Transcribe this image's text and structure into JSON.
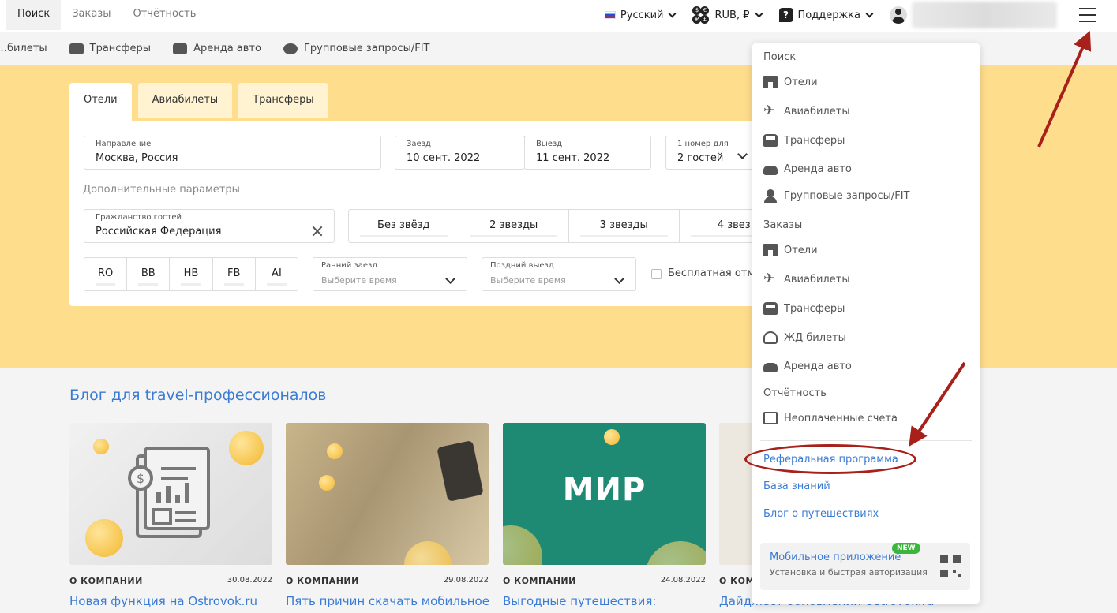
{
  "topnav": {
    "tabs": [
      "Поиск",
      "Заказы",
      "Отчётность"
    ]
  },
  "topright": {
    "language": "Русский",
    "currency": "RUB, ₽",
    "support": "Поддержка"
  },
  "subnav": {
    "items": [
      "…билеты",
      "Трансферы",
      "Аренда авто",
      "Групповые запросы/FIT"
    ]
  },
  "search": {
    "tabs": [
      "Отели",
      "Авиабилеты",
      "Трансферы"
    ],
    "destination": {
      "label": "Направление",
      "value": "Москва, Россия"
    },
    "checkin": {
      "label": "Заезд",
      "value": "10 сент. 2022"
    },
    "checkout": {
      "label": "Выезд",
      "value": "11 сент. 2022"
    },
    "rooms": {
      "label": "1 номер для",
      "value": "2 гостей"
    },
    "advanced": "Дополнительные параметры",
    "citizenship": {
      "label": "Гражданство гостей",
      "value": "Российская Федерация"
    },
    "stars": [
      "Без звёзд",
      "2 звезды",
      "3 звезды",
      "4 звез"
    ],
    "meals": [
      "RO",
      "BB",
      "HB",
      "FB",
      "AI"
    ],
    "early": {
      "label": "Ранний заезд",
      "placeholder": "Выберите время"
    },
    "late": {
      "label": "Поздний выезд",
      "placeholder": "Выберите время"
    },
    "free_cancel": "Бесплатная отме"
  },
  "blog": {
    "title": "Блог для travel-профессионалов",
    "posts": [
      {
        "category": "О КОМПАНИИ",
        "date": "30.08.2022",
        "title": "Новая функция на Ostrovok.ru"
      },
      {
        "category": "О КОМПАНИИ",
        "date": "29.08.2022",
        "title": "Пять причин скачать мобильное"
      },
      {
        "category": "О КОМПАНИИ",
        "date": "24.08.2022",
        "title": "Выгодные путешествия:",
        "image_text": "МИР"
      },
      {
        "category": "О КОМ",
        "date": "",
        "title": "Дайджест обновлений Ostrovok.ru"
      }
    ]
  },
  "menu": {
    "search_header": "Поиск",
    "search_items": [
      "Отели",
      "Авиабилеты",
      "Трансферы",
      "Аренда авто",
      "Групповые запросы/FIT"
    ],
    "orders_header": "Заказы",
    "orders_items": [
      "Отели",
      "Авиабилеты",
      "Трансферы",
      "ЖД билеты",
      "Аренда авто"
    ],
    "reports_header": "Отчётность",
    "reports_items": [
      "Неоплаченные счета"
    ],
    "links": [
      "Реферальная программа",
      "База знаний",
      "Блог о путешествиях"
    ],
    "app": {
      "title": "Мобильное приложение",
      "subtitle": "Установка и быстрая авторизация",
      "badge": "NEW"
    }
  },
  "colors": {
    "accent": "#3a7bd5",
    "hero": "#fedd8c",
    "annotation": "#a8201a"
  }
}
